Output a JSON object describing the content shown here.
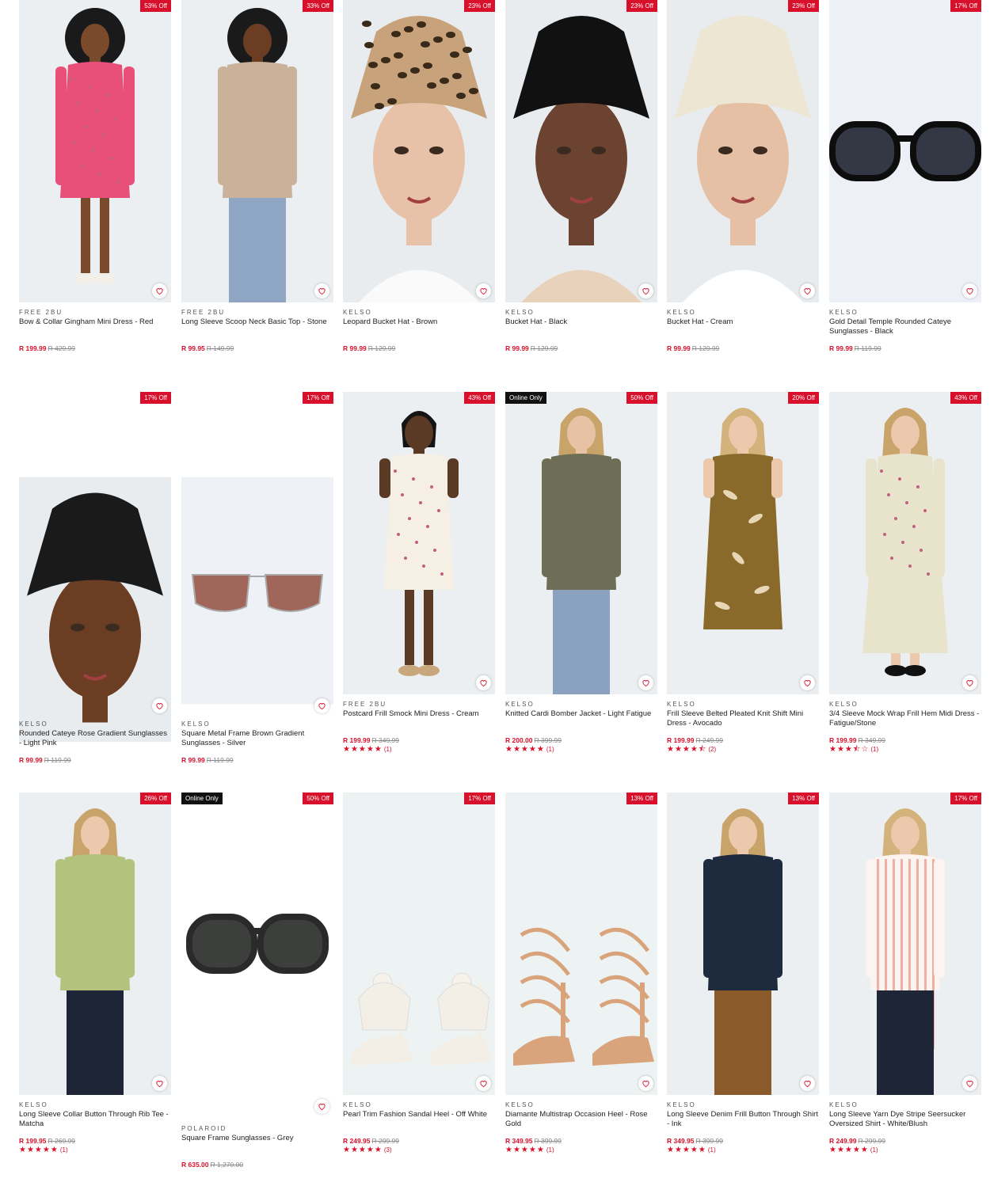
{
  "wishlist_icon": "heart-icon",
  "accent_color": "#d8102b",
  "products": [
    {
      "brand": "FREE 2BU",
      "title": "Bow & Collar Gingham Mini Dress - Red",
      "price": "R 199.99",
      "was": "R 429.99",
      "badge": "53% Off",
      "rating": null,
      "image": "woman-afro-pink-gingham-dress"
    },
    {
      "brand": "FREE 2BU",
      "title": "Long Sleeve Scoop Neck Basic Top - Stone",
      "price": "R 99.95",
      "was": "R 149.99",
      "badge": "33% Off",
      "rating": null,
      "image": "woman-afro-stone-top-jeans"
    },
    {
      "brand": "KELSO",
      "title": "Leopard Bucket Hat - Brown",
      "price": "R 99.99",
      "was": "R 129.99",
      "badge": "23% Off",
      "rating": null,
      "image": "woman-leopard-bucket-hat"
    },
    {
      "brand": "KELSO",
      "title": "Bucket Hat - Black",
      "price": "R 99.99",
      "was": "R 129.99",
      "badge": "23% Off",
      "rating": null,
      "image": "woman-black-bucket-hat"
    },
    {
      "brand": "KELSO",
      "title": "Bucket Hat - Cream",
      "price": "R 99.99",
      "was": "R 129.99",
      "badge": "23% Off",
      "rating": null,
      "image": "woman-cream-bucket-hat"
    },
    {
      "brand": "KELSO",
      "title": "Gold Detail Temple Rounded Cateye Sunglasses - Black",
      "price": "R 99.99",
      "was": "R 119.99",
      "badge": "17% Off",
      "rating": null,
      "image": "black-cateye-sunglasses"
    },
    {
      "brand": "KELSO",
      "title": "Rounded Cateye Rose Gradient Sunglasses - Light Pink",
      "price": "R 99.99",
      "was": "R 119.99",
      "badge": "17% Off",
      "rating": null,
      "image": "woman-rose-sunglasses"
    },
    {
      "brand": "KELSO",
      "title": "Square Metal Frame Brown Gradient Sunglasses - Silver",
      "price": "R 99.99",
      "was": "R 119.99",
      "badge": "17% Off",
      "rating": null,
      "image": "silver-metal-sunglasses"
    },
    {
      "brand": "FREE 2BU",
      "title": "Postcard Frill Smock Mini Dress - Cream",
      "price": "R 199.99",
      "was": "R 349.99",
      "badge": "43% Off",
      "rating": {
        "stars": 5,
        "count": "(1)"
      },
      "image": "woman-cream-floral-dress"
    },
    {
      "brand": "KELSO",
      "title": "Knitted Cardi Bomber Jacket - Light Fatigue",
      "price": "R 200.00",
      "was": "R 399.99",
      "badge": "Online Only",
      "badge2": "50% Off",
      "rating": {
        "stars": 5,
        "count": "(1)"
      },
      "image": "woman-fatigue-jacket-jeans"
    },
    {
      "brand": "KELSO",
      "title": "Frill Sleeve Belted Pleated Knit Shift Mini Dress - Avocado",
      "price": "R 199.99",
      "was": "R 249.99",
      "badge": "20% Off",
      "rating": {
        "stars": 4.5,
        "count": "(2)"
      },
      "image": "woman-avocado-leaf-dress"
    },
    {
      "brand": "KELSO",
      "title": "3/4 Sleeve Mock Wrap Frill Hem Midi Dress - Fatigue/Stone",
      "price": "R 199.99",
      "was": "R 349.99",
      "badge": "43% Off",
      "rating": {
        "stars": 3.5,
        "count": "(1)"
      },
      "image": "woman-stone-midi-dress"
    },
    {
      "brand": "KELSO",
      "title": "Long Sleeve Collar Button Through Rib Tee - Matcha",
      "price": "R 199.95",
      "was": "R 269.99",
      "badge": "26% Off",
      "rating": {
        "stars": 5,
        "count": "(1)"
      },
      "image": "woman-matcha-rib-tee"
    },
    {
      "brand": "POLAROID",
      "title": "Square Frame Sunglasses - Grey",
      "price": "R 635.00",
      "was": "R 1,270.00",
      "badge": "Online Only",
      "badge2": "50% Off",
      "rating": null,
      "image": "grey-square-sunglasses"
    },
    {
      "brand": "KELSO",
      "title": "Pearl Trim Fashion Sandal Heel - Off White",
      "price": "R 249.95",
      "was": "R 299.99",
      "badge": "17% Off",
      "rating": {
        "stars": 5,
        "count": "(3)"
      },
      "image": "off-white-pearl-heels"
    },
    {
      "brand": "KELSO",
      "title": "Diamante Multistrap Occasion Heel - Rose Gold",
      "price": "R 349.95",
      "was": "R 399.99",
      "badge": "13% Off",
      "rating": {
        "stars": 5,
        "count": "(1)"
      },
      "image": "rose-gold-strap-heels"
    },
    {
      "brand": "KELSO",
      "title": "Long Sleeve Denim Frill Button Through Shirt - Ink",
      "price": "R 349.95",
      "was": "R 399.99",
      "badge": "13% Off",
      "rating": {
        "stars": 5,
        "count": "(1)"
      },
      "image": "woman-ink-denim-shirt"
    },
    {
      "brand": "KELSO",
      "title": "Long Sleeve Yarn Dye Stripe Seersucker Oversized Shirt - White/Blush",
      "price": "R 249.99",
      "was": "R 299.99",
      "badge": "17% Off",
      "rating": {
        "stars": 5,
        "count": "(1)"
      },
      "image": "woman-blush-stripe-shirt"
    }
  ]
}
